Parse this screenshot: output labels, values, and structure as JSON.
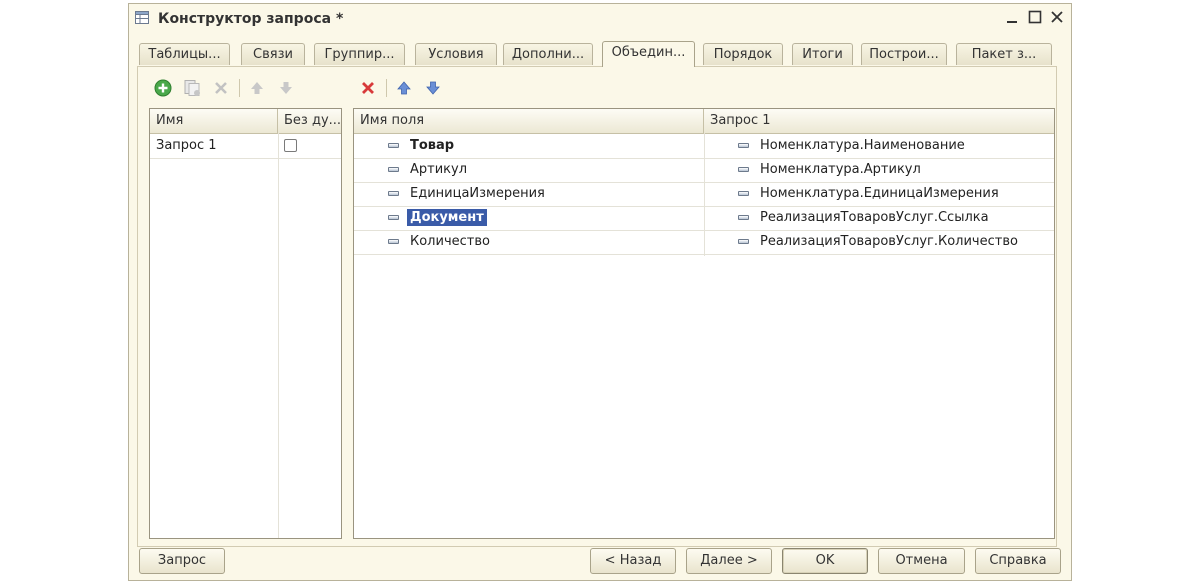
{
  "window": {
    "title": "Конструктор запроса *"
  },
  "tabs": [
    {
      "label": "Таблицы..."
    },
    {
      "label": "Связи"
    },
    {
      "label": "Группир..."
    },
    {
      "label": "Условия"
    },
    {
      "label": "Дополни..."
    },
    {
      "label": "Объедин..."
    },
    {
      "label": "Порядок"
    },
    {
      "label": "Итоги"
    },
    {
      "label": "Построи..."
    },
    {
      "label": "Пакет з..."
    }
  ],
  "active_tab": "Объедин...",
  "left_toolbar": [
    "add-icon",
    "copy-icon",
    "delete-icon",
    "move-up-icon",
    "move-down-icon"
  ],
  "right_toolbar": [
    "delete-icon",
    "move-up-icon",
    "move-down-icon"
  ],
  "queries_table": {
    "columns": [
      "Имя",
      "Без ду..."
    ],
    "rows": [
      {
        "name": "Запрос 1",
        "no_duplicates": false
      }
    ]
  },
  "fields_table": {
    "columns": [
      "Имя поля",
      "Запрос 1"
    ],
    "rows": [
      {
        "field": "Товар",
        "source": "Номенклатура.Наименование",
        "bold": true
      },
      {
        "field": "Артикул",
        "source": "Номенклатура.Артикул"
      },
      {
        "field": "ЕдиницаИзмерения",
        "source": "Номенклатура.ЕдиницаИзмерения"
      },
      {
        "field": "Документ",
        "source": "РеализацияТоваровУслуг.Ссылка",
        "selected": true
      },
      {
        "field": "Количество",
        "source": "РеализацияТоваровУслуг.Количество"
      }
    ]
  },
  "buttons": {
    "query": "Запрос",
    "back": "< Назад",
    "next": "Далее >",
    "ok": "OK",
    "cancel": "Отмена",
    "help": "Справка"
  },
  "colors": {
    "selection": "#3a5ba8",
    "add": "#4aa84a",
    "delete": "#d83a3a",
    "arrow": "#5a7fc8"
  }
}
